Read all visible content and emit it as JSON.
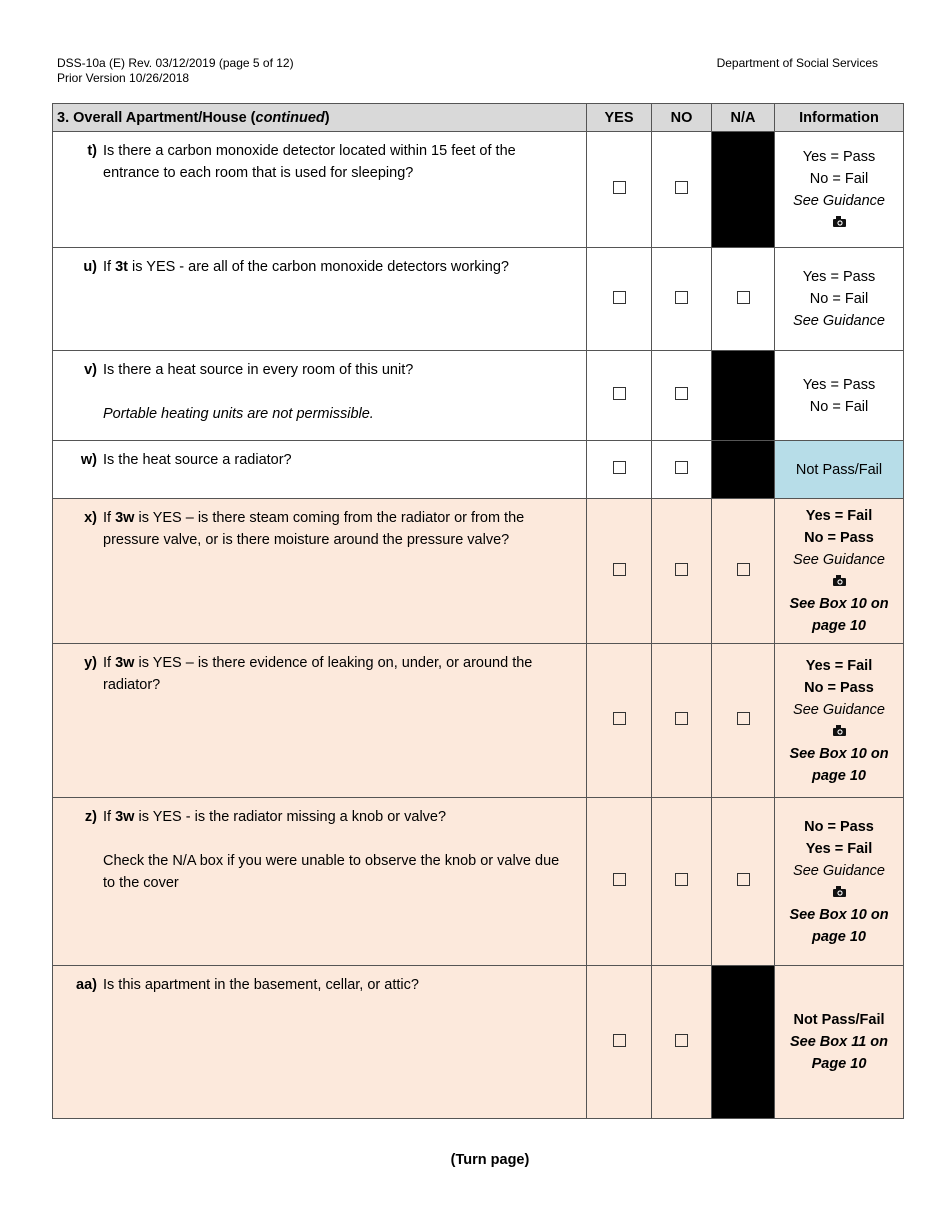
{
  "header": {
    "form_id": "DSS-10a (E) Rev.  03/12/2019 (page 5 of 12)",
    "prior_version": "Prior Version 10/26/2018",
    "department": "Department of Social Services"
  },
  "table": {
    "section_title": "3. Overall Apartment/House (",
    "section_title_italic": "continued",
    "section_title_end": ")",
    "columns": [
      "YES",
      "NO",
      "N/A",
      "Information"
    ],
    "rows": [
      {
        "label": "t)",
        "question": "Is there a carbon monoxide detector located within 15 feet of the entrance to each room that is used for sleeping?",
        "info": [
          "Yes = Pass",
          "No = Fail",
          "See Guidance"
        ]
      },
      {
        "label": "u)",
        "q_pre": "If ",
        "q_bold": "3t",
        "q_post": " is YES - are all of the carbon monoxide detectors working?",
        "info": [
          "Yes = Pass",
          "No = Fail",
          "See Guidance"
        ]
      },
      {
        "label": "v)",
        "question": "Is there a heat source in every room of this unit?",
        "note": "Portable heating units are not permissible.",
        "info": [
          "Yes = Pass",
          "No = Fail"
        ]
      },
      {
        "label": "w)",
        "question": "Is the heat source a radiator?",
        "info": [
          "Not Pass/Fail"
        ]
      },
      {
        "label": "x)",
        "q_pre": "If ",
        "q_bold": "3w",
        "q_post": " is YES – is there steam coming from the radiator or from the pressure valve, or is there moisture around the pressure valve?",
        "info": [
          "Yes = Fail",
          "No = Pass",
          "See Guidance",
          "See Box 10 on page 10"
        ]
      },
      {
        "label": "y)",
        "q_pre": "If ",
        "q_bold": "3w",
        "q_post": " is YES – is there evidence of leaking on, under, or around the radiator?",
        "info": [
          "Yes = Fail",
          "No = Pass",
          "See Guidance",
          "See Box 10 on page 10"
        ]
      },
      {
        "label": "z)",
        "q_pre": "If ",
        "q_bold": "3w",
        "q_post": " is YES - is the radiator missing a knob or valve?",
        "note": "Check the N/A box if you were unable to observe the knob or valve due to the cover",
        "info": [
          "No = Pass",
          "Yes = Fail",
          "See Guidance",
          "See Box 10 on page 10"
        ]
      },
      {
        "label": "aa)",
        "question": "Is this apartment in the basement, cellar, or attic?",
        "info": [
          "Not Pass/Fail",
          "See Box 11 on Page 10"
        ]
      }
    ]
  },
  "icons": {
    "guidance": "camera-icon",
    "checkbox": "checkbox-icon"
  },
  "colors": {
    "peach": "#fce9dc",
    "blue": "#b7dde8",
    "header": "#d9d9d9"
  },
  "footer": "(Turn page)"
}
